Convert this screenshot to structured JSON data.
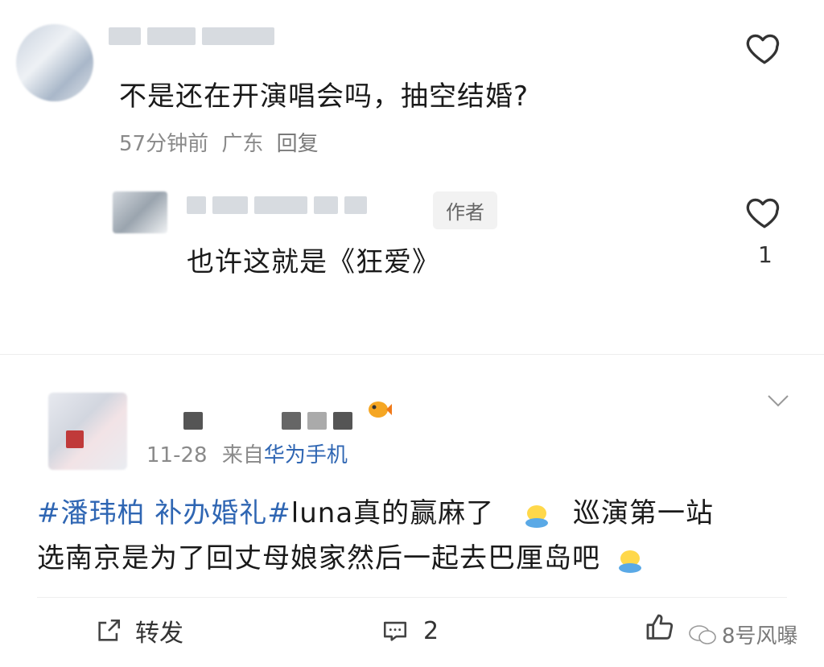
{
  "comment1": {
    "text": "不是还在开演唱会吗，抽空结婚?",
    "time": "57分钟前",
    "location": "广东",
    "reply_label": "回复"
  },
  "reply1": {
    "badge": "作者",
    "text": "也许这就是《狂爱》",
    "like_count": "1"
  },
  "post": {
    "date": "11-28",
    "source_prefix": "来自",
    "source_device": "华为手机",
    "topic": "#潘玮柏 补办婚礼#",
    "line1_rest": "luna真的赢麻了",
    "line1_tail": "巡演第一站",
    "line2": "选南京是为了回丈母娘家然后一起去巴厘岛吧"
  },
  "actions": {
    "repost_label": "转发",
    "comment_count": "2"
  },
  "watermark": "8号风曝"
}
